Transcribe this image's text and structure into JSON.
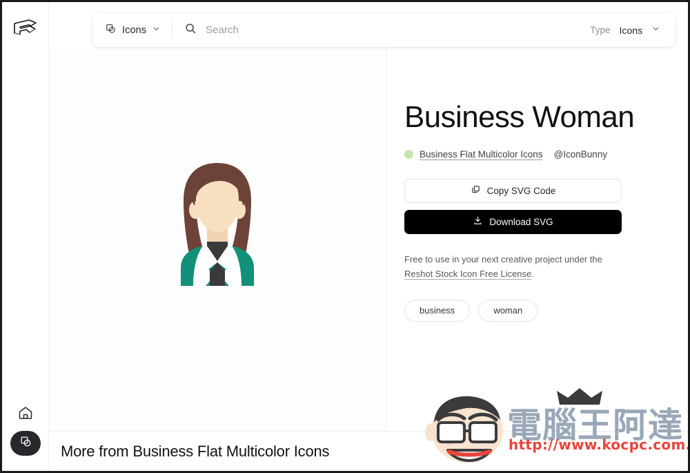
{
  "sidebar": {
    "logo_name": "reshot-logo",
    "home_label": "home-icon",
    "icons_button_label": "icons-icon"
  },
  "search": {
    "type_selector_label": "Icons",
    "placeholder": "Search",
    "search_value": "",
    "chevron": "⌄",
    "search_icon": "search-icon",
    "type_icon": "shapes-icon"
  },
  "header_right": {
    "type_label": "Type",
    "type_value": "Icons",
    "chevron": "⌄"
  },
  "detail": {
    "title": "Business Woman",
    "collection": "Business Flat Multicolor Icons",
    "author": "@IconBunny",
    "copy_button": "Copy SVG Code",
    "download_button": "Download SVG",
    "license_text": "Free to use in your next creative project under the",
    "license_link": "Reshot Stock Icon Free License",
    "license_period": ".",
    "tags": [
      "business",
      "woman"
    ]
  },
  "bottom": {
    "more_from": "More from Business Flat Multicolor Icons"
  },
  "watermark": {
    "brand": "電腦王阿達",
    "url": "http://www.kocpc.com.tw"
  },
  "colors": {
    "accent_dot": "#c4e5b0",
    "download_bg": "#000000",
    "blazer_teal": "#129079",
    "hair_brown": "#6d4238",
    "skin": "#f7dfc0",
    "shirt_dark": "#3a3a3d",
    "collar_white": "#ffffff",
    "watermark_blue": "#9aa7b8",
    "watermark_red": "#e8453c"
  }
}
